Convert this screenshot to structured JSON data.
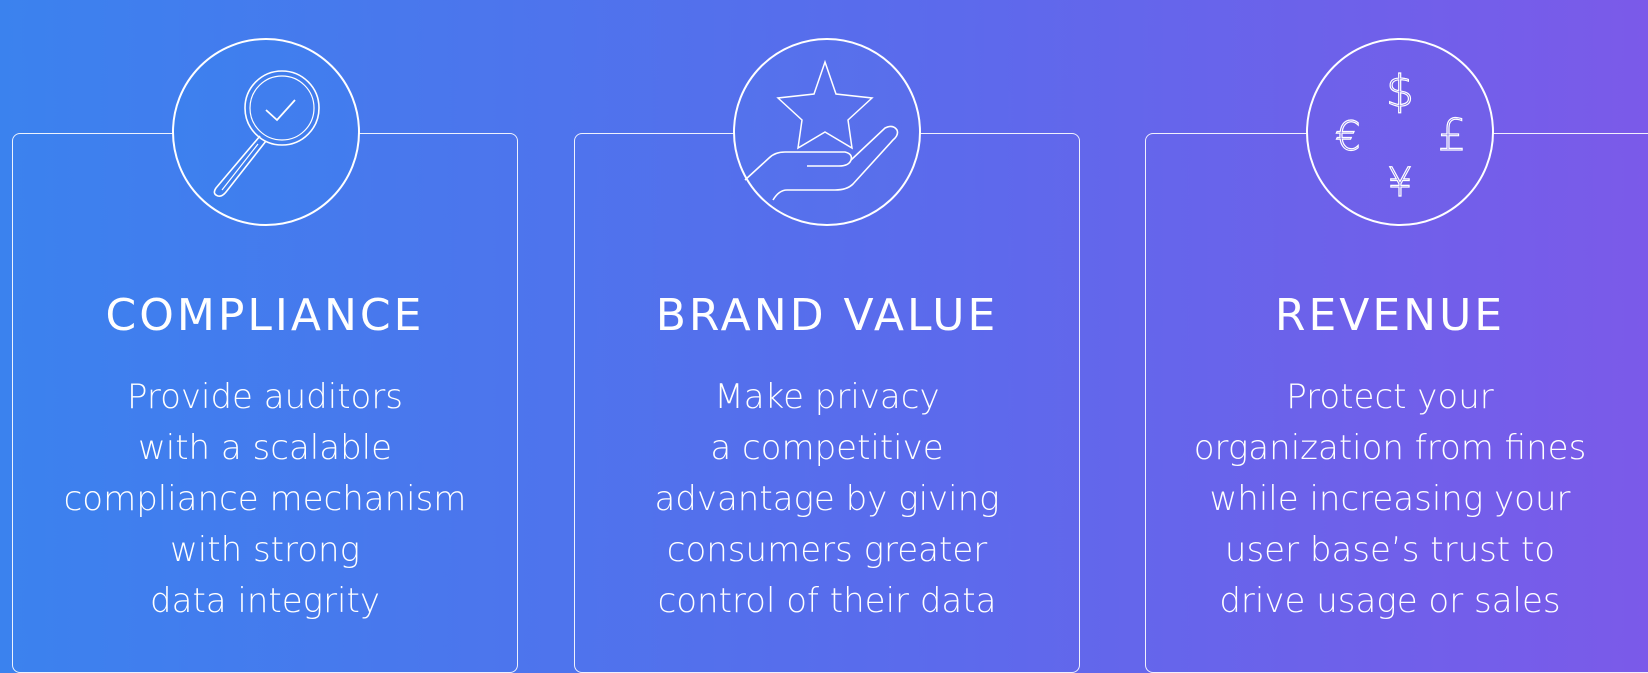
{
  "cards": [
    {
      "title": "COMPLIANCE",
      "description": "Provide auditors\nwith a scalable\ncompliance mechanism\nwith strong\ndata integrity",
      "icon": "magnifier-check-icon"
    },
    {
      "title": "BRAND VALUE",
      "description": "Make privacy\na competitive\nadvantage by giving\nconsumers greater\ncontrol of their data",
      "icon": "hand-star-icon"
    },
    {
      "title": "REVENUE",
      "description": "Protect your\norganization from fines\nwhile increasing your\nuser base’s trust to\ndrive usage or sales",
      "icon": "currency-symbols-icon",
      "currency_symbols": [
        "$",
        "€",
        "£",
        "¥"
      ]
    }
  ],
  "colors": {
    "gradient_start": "#3b82ee",
    "gradient_end": "#7b5ae9",
    "line": "#ffffff"
  }
}
